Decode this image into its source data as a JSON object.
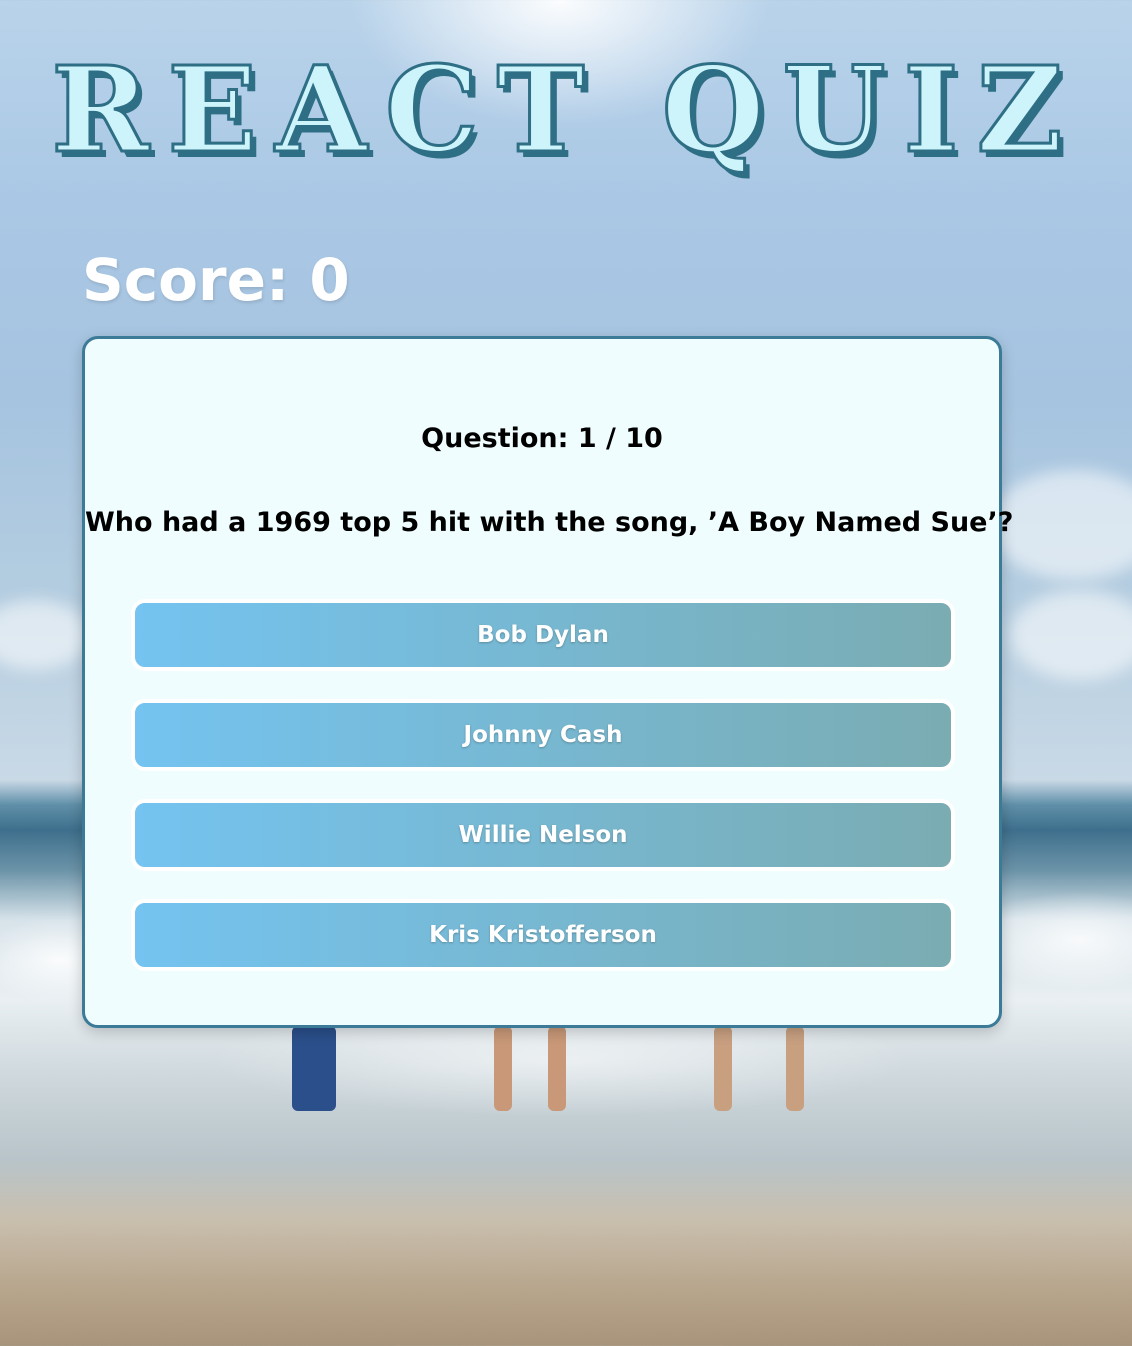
{
  "app": {
    "title": "REACT QUIZ"
  },
  "score": {
    "label": "Score: 0",
    "value": 0
  },
  "quiz": {
    "question_counter": "Question: 1 / 10",
    "current_question": 1,
    "total_questions": 10,
    "question_text": "Who had a 1969 top 5 hit with the song, ’A Boy Named Sue’?",
    "answers": [
      {
        "label": "Bob Dylan"
      },
      {
        "label": "Johnny Cash"
      },
      {
        "label": "Willie Nelson"
      },
      {
        "label": "Kris Kristofferson"
      }
    ]
  },
  "colors": {
    "title_fill": "#cdf3fb",
    "title_stroke": "#2f6f86",
    "card_background": "#f0fdfe",
    "card_border": "#3b7b98",
    "answer_gradient_start": "#74c3f0",
    "answer_gradient_end": "#7aacb2"
  }
}
